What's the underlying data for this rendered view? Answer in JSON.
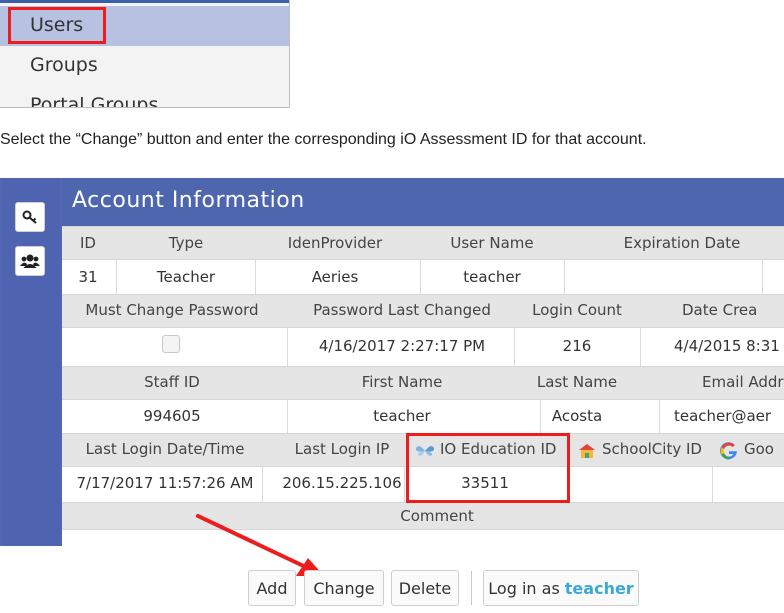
{
  "menu": {
    "items": [
      "Users",
      "Groups",
      "Portal Groups"
    ]
  },
  "instruction": "Select the “Change” button and enter the corresponding iO Assessment ID for that account.",
  "panel": {
    "title": "Account Information",
    "sidebar_icons": [
      "key-icon",
      "users-icon"
    ],
    "row1_headers": [
      "ID",
      "Type",
      "IdenProvider",
      "User Name",
      "Expiration Date"
    ],
    "row1_values": [
      "31",
      "Teacher",
      "Aeries",
      "teacher",
      ""
    ],
    "row2_headers": [
      "Must Change Password",
      "Password Last Changed",
      "Login Count",
      "Date Crea"
    ],
    "row2_values": [
      "",
      "4/16/2017 2:27:17 PM",
      "216",
      "4/4/2015 8:31"
    ],
    "row3_headers": [
      "Staff ID",
      "First Name",
      "Last Name",
      "Email Addr"
    ],
    "row3_values": [
      "994605",
      "teacher",
      "Acosta",
      "teacher@aer"
    ],
    "row4_headers": [
      "Last Login Date/Time",
      "Last Login IP",
      "IO Education ID",
      "SchoolCity ID",
      "Goo"
    ],
    "row4_values": [
      "7/17/2017 11:57:26 AM",
      "206.15.225.106",
      "33511",
      "",
      ""
    ],
    "comment_label": "Comment"
  },
  "buttons": {
    "add": "Add",
    "change": "Change",
    "delete": "Delete",
    "login_prefix": "Log in as",
    "login_user": "teacher"
  },
  "colors": {
    "accent": "#4e66ad",
    "highlight": "#ee1c1c"
  }
}
